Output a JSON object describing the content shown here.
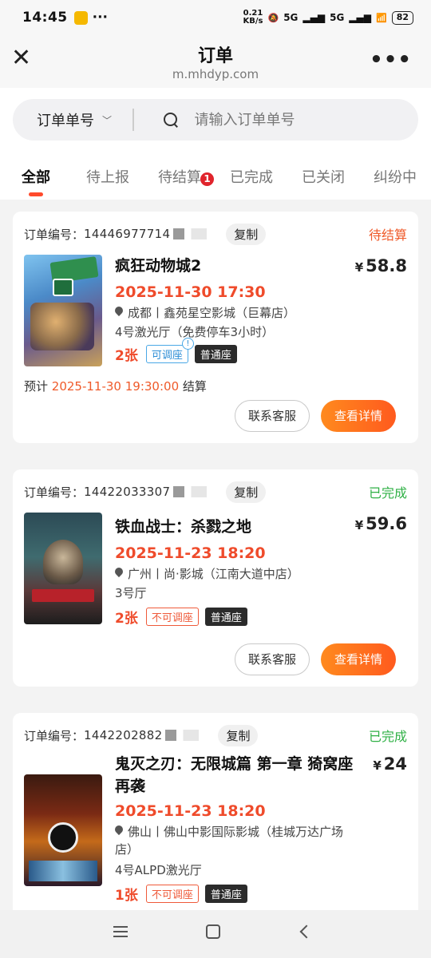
{
  "status_bar": {
    "time": "14:45",
    "net_speed_value": "0.21",
    "net_speed_unit": "KB/s",
    "signal_1": "5G",
    "signal_2": "5G",
    "battery": "82"
  },
  "header": {
    "title": "订单",
    "url": "m.mhdyp.com"
  },
  "search": {
    "type_label": "订单单号",
    "placeholder": "请输入订单单号"
  },
  "tabs": [
    {
      "label": "全部",
      "active": true
    },
    {
      "label": "待上报"
    },
    {
      "label": "待结算",
      "badge": "1"
    },
    {
      "label": "已完成"
    },
    {
      "label": "已关闭"
    },
    {
      "label": "纠纷中"
    }
  ],
  "labels": {
    "order_no": "订单编号：",
    "copy": "复制",
    "contact": "联系客服",
    "details": "查看详情",
    "settle_prefix": "预计",
    "settle_suffix": "结算",
    "currency": "¥"
  },
  "orders": [
    {
      "order_no": "14446977714",
      "status": "待结算",
      "movie": "疯狂动物城2",
      "price": "58.8",
      "showtime": "2025-11-30 17:30",
      "cinema": "成都丨鑫苑星空影城（巨幕店）",
      "hall": "4号激光厅（免费停车3小时）",
      "qty": "2张",
      "seat_tag": "可调座",
      "seat_type": "普通座",
      "settle_time": "2025-11-30 19:30:00"
    },
    {
      "order_no": "14422033307",
      "status": "已完成",
      "movie": "铁血战士：杀戮之地",
      "price": "59.6",
      "showtime": "2025-11-23 18:20",
      "cinema": "广州丨尚·影城（江南大道中店）",
      "hall": "3号厅",
      "qty": "2张",
      "seat_tag": "不可调座",
      "seat_type": "普通座"
    },
    {
      "order_no": "1442202882",
      "status": "已完成",
      "movie_line1": "鬼灭之刃：无限城篇 第一章 猗窝座",
      "movie_line2": "再袭",
      "price": "24",
      "showtime": "2025-11-23 18:20",
      "cinema_line1": "佛山丨佛山中影国际影城（桂城万达广场",
      "cinema_line2": "店）",
      "hall": "4号ALPD激光厅",
      "qty": "1张",
      "seat_tag": "不可调座",
      "seat_type": "普通座"
    }
  ],
  "colors": {
    "accent": "#ff4a2c",
    "pending": "#ef5a2a",
    "done": "#2fb045"
  }
}
